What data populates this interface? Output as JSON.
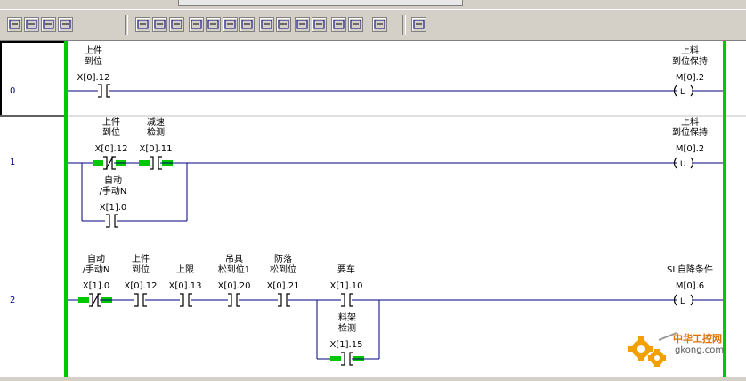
{
  "rungs": [
    {
      "number": "0",
      "contacts": [
        {
          "label1": "上件",
          "label2": "到位",
          "addr": "X[0].12"
        }
      ],
      "coil": {
        "label1": "上料",
        "label2": "到位保持",
        "addr": "M[0].2",
        "symbol": "L"
      }
    },
    {
      "number": "1",
      "contacts": [
        {
          "label1": "上件",
          "label2": "到位",
          "addr": "X[0].12"
        },
        {
          "label1": "减速",
          "label2": "检测",
          "addr": "X[0].11"
        }
      ],
      "branch": {
        "label1": "自动",
        "label2": "/手动N",
        "addr": "X[1].0"
      },
      "coil": {
        "label1": "上料",
        "label2": "到位保持",
        "addr": "M[0].2",
        "symbol": "U"
      }
    },
    {
      "number": "2",
      "contacts": [
        {
          "label1": "自动",
          "label2": "/手动N",
          "addr": "X[1].0"
        },
        {
          "label1": "上件",
          "label2": "到位",
          "addr": "X[0].12"
        },
        {
          "label1": "",
          "label2": "上限",
          "addr": "X[0].13"
        },
        {
          "label1": "吊具",
          "label2": "松到位1",
          "addr": "X[0].20"
        },
        {
          "label1": "防落",
          "label2": "松到位",
          "addr": "X[0].21"
        },
        {
          "label1": "",
          "label2": "要车",
          "addr": "X[1].10"
        }
      ],
      "branch": {
        "label1": "料架",
        "label2": "检测",
        "addr": "X[1].15"
      },
      "coil": {
        "label1": "",
        "label2": "SL自降条件",
        "addr": "M[0].6",
        "symbol": "L"
      }
    }
  ],
  "watermark": {
    "text1": "中华工控网",
    "text2": "gkong.com"
  },
  "colors": {
    "rail": "#00c800",
    "wire": "#000080",
    "highlight": "#00c800",
    "toolbar": "#d4d0c8"
  }
}
